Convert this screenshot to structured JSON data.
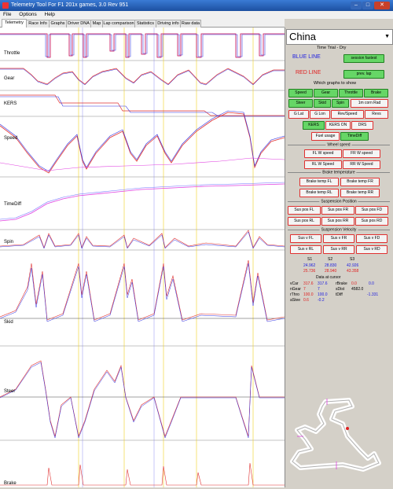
{
  "window": {
    "title": "Telemetry Tool For F1 201x games, 3.0 Rev 951"
  },
  "menu": [
    "File",
    "Options",
    "Help"
  ],
  "tabs": [
    "Telemetry",
    "Race Info",
    "Graphs",
    "Driver DNA",
    "Map",
    "Lap comparison",
    "Statistics",
    "Driving info",
    "Raw data"
  ],
  "graph_labels": [
    "Throttle",
    "Gear",
    "KERS",
    "Speed",
    "TimeDiff",
    "Spin",
    "Skid",
    "Steer",
    "Brake"
  ],
  "panel": {
    "track": "China",
    "session": "Time Trial  -  Dry",
    "blue_line": "BLUE LINE",
    "red_line": "RED LINE",
    "session_fastest": "session fastest",
    "prev_lap": "prev. lap",
    "which_graphs": "Which graphs to show",
    "graph_buttons": [
      "Speed",
      "Gear",
      "Throttle",
      "Brake",
      "Steer",
      "Skid",
      "Spin",
      "1m corn Rad",
      "G Lat",
      "G Lon",
      "Rev/Speed",
      "Revs",
      "KERS",
      "KERS ON",
      "DRS",
      "Fuel usage",
      "TimeDiff"
    ],
    "wheel_speed_title": "Wheel speed",
    "wheel_speed": [
      "FL W speed",
      "FR W speed",
      "RL W Speed",
      "RR W Speed"
    ],
    "brake_temp_title": "Brake temperature",
    "brake_temp": [
      "Brake temp FL",
      "Brake temp FR",
      "Brake temp RL",
      "Brake temp RR"
    ],
    "susp_pos_title": "Suspension Position",
    "susp_pos": [
      "Sus pos FL",
      "Sus pos FR",
      "Sus pos FD",
      "Sus pos RL",
      "Sus pos RR",
      "Sus pos RD"
    ],
    "susp_vel_title": "Suspension Velocity",
    "susp_vel": [
      "Sus v FL",
      "Sus v FR",
      "Sus v FD",
      "Sus v RL",
      "Sus v RR",
      "Sus v RD"
    ],
    "sectors": {
      "headers": [
        "S1",
        "S2",
        "S3"
      ],
      "blue": [
        "24.962",
        "28.830",
        "42.926"
      ],
      "red": [
        "25.736",
        "28.940",
        "43.358"
      ]
    },
    "cursor_title": "Data at cursor",
    "cursor_rows": [
      [
        "vCar",
        "317.6",
        "317.6",
        "rBrake",
        "0.0",
        "0.0"
      ],
      [
        "nGear",
        "7",
        "7",
        "sDist",
        "4582.0",
        ""
      ],
      [
        "rThro",
        "100.0",
        "100.0",
        "tDiff",
        "",
        "-1.331"
      ],
      [
        "aStee",
        "0.6",
        "-0.2",
        "",
        "",
        ""
      ]
    ]
  }
}
